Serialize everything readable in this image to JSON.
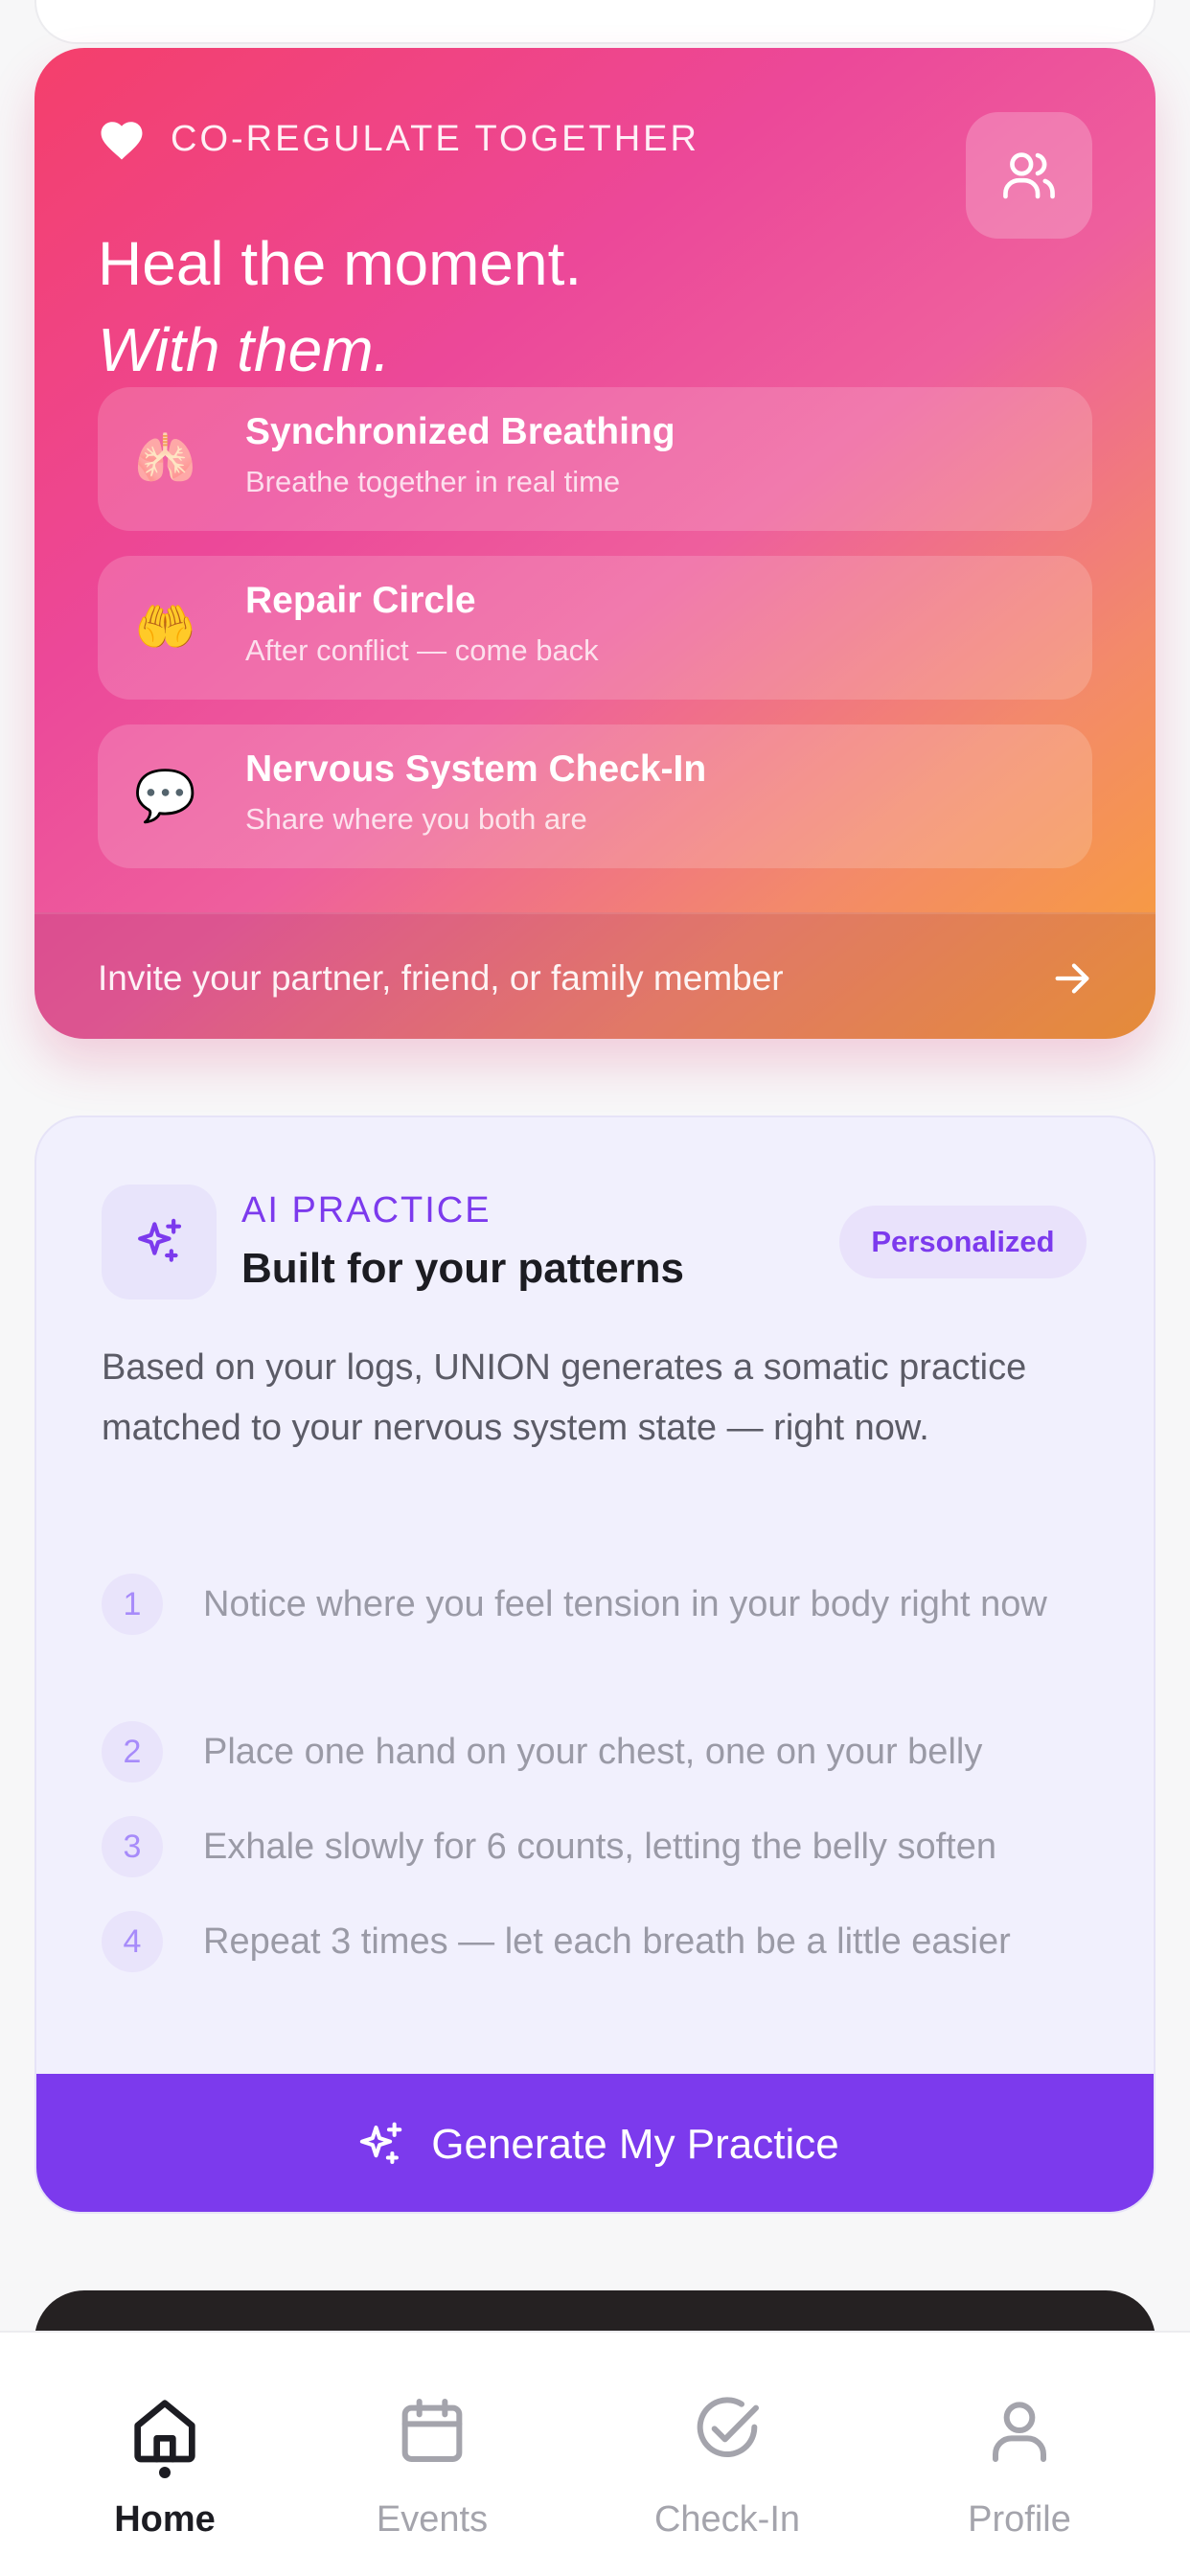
{
  "coregulate": {
    "kicker": "CO-REGULATE TOGETHER",
    "title": "Heal the moment.",
    "subtitle": "With them.",
    "features": [
      {
        "icon": "🫁",
        "title": "Synchronized Breathing",
        "subtitle": "Breathe together in real time"
      },
      {
        "icon": "🤲",
        "title": "Repair Circle",
        "subtitle": "After conflict — come back"
      },
      {
        "icon": "💬",
        "title": "Nervous System Check-In",
        "subtitle": "Share where you both are"
      }
    ],
    "invite_text": "Invite your partner, friend, or family member",
    "gradient_colors": [
      "#f43f6b",
      "#ec4899",
      "#f8a035"
    ]
  },
  "ai_practice": {
    "kicker": "AI PRACTICE",
    "title": "Built for your patterns",
    "badge": "Personalized",
    "description": "Based on your logs, UNION generates a somatic practice matched to your nervous system state — right now.",
    "steps": [
      {
        "num": "1",
        "text": "Notice where you feel tension in your body right now"
      },
      {
        "num": "2",
        "text": "Place one hand on your chest, one on your belly"
      },
      {
        "num": "3",
        "text": "Exhale slowly for 6 counts, letting the belly soften"
      },
      {
        "num": "4",
        "text": "Repeat 3 times — let each breath be a little easier"
      }
    ],
    "button_label": "Generate My Practice",
    "accent_color": "#7c3aed"
  },
  "tabbar": {
    "tabs": [
      {
        "label": "Home",
        "icon": "home-icon",
        "active": true
      },
      {
        "label": "Events",
        "icon": "calendar-icon",
        "active": false
      },
      {
        "label": "Check-In",
        "icon": "check-circle-icon",
        "active": false
      },
      {
        "label": "Profile",
        "icon": "person-icon",
        "active": false
      }
    ]
  }
}
